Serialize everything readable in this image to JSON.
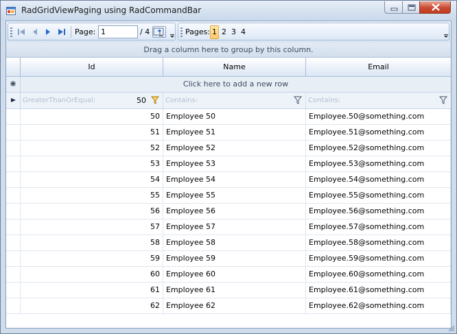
{
  "window": {
    "title": "RadGridViewPaging using RadCommandBar",
    "icon": "app-window-icon"
  },
  "commandbar": {
    "page_label": "Page:",
    "page_value": "1",
    "page_total": "/ 4",
    "pages_label": "Pages:",
    "pages": [
      "1",
      "2",
      "3",
      "4"
    ],
    "active_page": "1"
  },
  "grid": {
    "group_panel_text": "Drag a column here to group by this column.",
    "columns": [
      "Id",
      "Name",
      "Email"
    ],
    "new_row_text": "Click here to add a new row",
    "filters": {
      "id_operator": "GreaterThanOrEqual:",
      "id_value": "50",
      "name_operator": "Contains:",
      "email_operator": "Contains:"
    },
    "rows": [
      {
        "id": "50",
        "name": "Employee 50",
        "email": "Employee.50@something.com"
      },
      {
        "id": "51",
        "name": "Employee 51",
        "email": "Employee.51@something.com"
      },
      {
        "id": "52",
        "name": "Employee 52",
        "email": "Employee.52@something.com"
      },
      {
        "id": "53",
        "name": "Employee 53",
        "email": "Employee.53@something.com"
      },
      {
        "id": "54",
        "name": "Employee 54",
        "email": "Employee.54@something.com"
      },
      {
        "id": "55",
        "name": "Employee 55",
        "email": "Employee.55@something.com"
      },
      {
        "id": "56",
        "name": "Employee 56",
        "email": "Employee.56@something.com"
      },
      {
        "id": "57",
        "name": "Employee 57",
        "email": "Employee.57@something.com"
      },
      {
        "id": "58",
        "name": "Employee 58",
        "email": "Employee.58@something.com"
      },
      {
        "id": "59",
        "name": "Employee 59",
        "email": "Employee.59@something.com"
      },
      {
        "id": "60",
        "name": "Employee 60",
        "email": "Employee.60@something.com"
      },
      {
        "id": "61",
        "name": "Employee 61",
        "email": "Employee.61@something.com"
      },
      {
        "id": "62",
        "name": "Employee 62",
        "email": "Employee.62@something.com"
      }
    ]
  },
  "colors": {
    "accent": "#ffc96a",
    "header_border": "#a9bdd8",
    "close_button": "#c84a30"
  }
}
